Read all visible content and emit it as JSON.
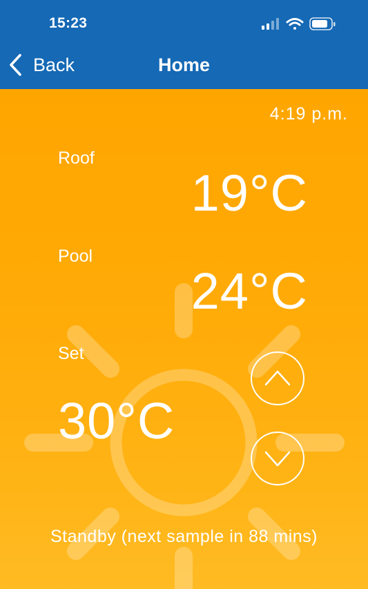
{
  "status_bar": {
    "time": "15:23",
    "icons": [
      "signal-icon",
      "wifi-icon",
      "battery-icon"
    ]
  },
  "nav": {
    "back_label": "Back",
    "title": "Home"
  },
  "clock": "4:19 p.m.",
  "roof": {
    "label": "Roof",
    "value": "19°C"
  },
  "pool": {
    "label": "Pool",
    "value": "24°C"
  },
  "set": {
    "label": "Set",
    "value": "30°C"
  },
  "controls": {
    "up_icon": "chevron-up-icon",
    "down_icon": "chevron-down-icon"
  },
  "status_text": "Standby (next sample in 88 mins)",
  "colors": {
    "nav_background": "#1569b5",
    "content_background": "#ffa500",
    "text": "#ffffff"
  }
}
